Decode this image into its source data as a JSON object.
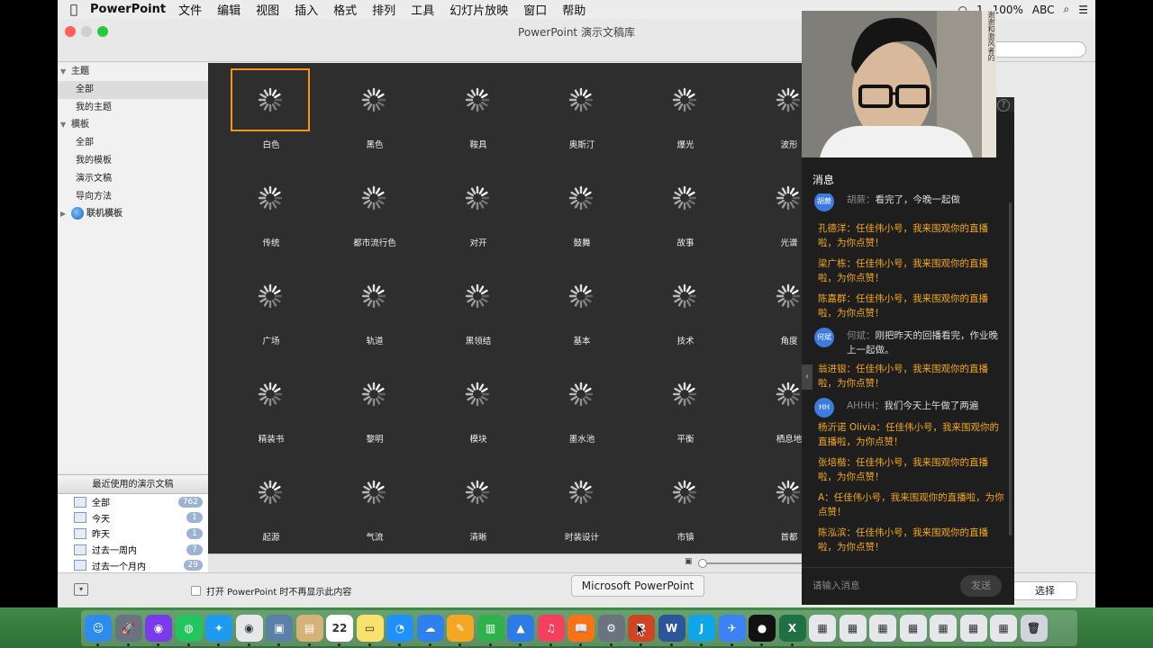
{
  "menubar": {
    "app": "PowerPoint",
    "items": [
      "文件",
      "编辑",
      "视图",
      "插入",
      "格式",
      "排列",
      "工具",
      "幻灯片放映",
      "窗口",
      "帮助"
    ],
    "status": {
      "badge": "1",
      "battery": "100%",
      "input": "ABC"
    }
  },
  "window": {
    "title": "PowerPoint 演示文稿库"
  },
  "sidebar": {
    "items": [
      {
        "label": "主题",
        "type": "head"
      },
      {
        "label": "全部",
        "type": "item",
        "selected": true
      },
      {
        "label": "我的主题",
        "type": "item"
      },
      {
        "label": "模板",
        "type": "head"
      },
      {
        "label": "全部",
        "type": "item"
      },
      {
        "label": "我的模板",
        "type": "item"
      },
      {
        "label": "演示文稿",
        "type": "item"
      },
      {
        "label": "导向方法",
        "type": "item"
      },
      {
        "label": "联机模板",
        "type": "online"
      }
    ]
  },
  "recent": {
    "header": "最近使用的演示文稿",
    "items": [
      {
        "label": "全部",
        "count": "762"
      },
      {
        "label": "今天",
        "count": "1"
      },
      {
        "label": "昨天",
        "count": "1"
      },
      {
        "label": "过去一周内",
        "count": "7"
      },
      {
        "label": "过去一个月内",
        "count": "29"
      }
    ]
  },
  "gallery": {
    "themes": [
      "白色",
      "黑色",
      "鞍具",
      "奥斯汀",
      "爆光",
      "波形",
      "传统",
      "都市流行色",
      "对开",
      "鼓舞",
      "故事",
      "光谱",
      "广场",
      "轨道",
      "黑领结",
      "基本",
      "技术",
      "角度",
      "精装书",
      "黎明",
      "模块",
      "墨水池",
      "平衡",
      "栖息地",
      "起源",
      "气流",
      "清晰",
      "时装设计",
      "市镇",
      "首都"
    ],
    "selected_index": 0
  },
  "footer": {
    "checkbox_label": "打开 PowerPoint 时不再显示此内容",
    "select_button": "选择"
  },
  "tooltip": "Microsoft PowerPoint",
  "webcam": {
    "side_text": "谢谢和激风者的"
  },
  "chat": {
    "title": "消息",
    "messages": [
      {
        "kind": "user",
        "avatar": "胡蕨",
        "name": "胡蕨：",
        "text": "看完了，今晚一起做"
      },
      {
        "kind": "gift",
        "text": "孔德洋：任佳伟小号，我来围观你的直播啦，为你点赞！"
      },
      {
        "kind": "gift",
        "text": "梁广栋：任佳伟小号，我来围观你的直播啦，为你点赞！"
      },
      {
        "kind": "gift",
        "text": "陈嘉群：任佳伟小号，我来围观你的直播啦，为你点赞！"
      },
      {
        "kind": "user",
        "avatar": "何斌",
        "name": "何斌：",
        "text": "刚把昨天的回播看完，作业晚上一起做。"
      },
      {
        "kind": "gift",
        "text": "翁进银：任佳伟小号，我来围观你的直播啦，为你点赞！"
      },
      {
        "kind": "user",
        "avatar": "HH",
        "name": "AHHH：",
        "text": "我们今天上午做了两遍"
      },
      {
        "kind": "gift",
        "text": "杨沂诺 Olivia：任佳伟小号，我来围观你的直播啦，为你点赞！"
      },
      {
        "kind": "gift",
        "text": "张培楷：任佳伟小号，我来围观你的直播啦，为你点赞！"
      },
      {
        "kind": "gift",
        "text": "A：任佳伟小号，我来围观你的直播啦，为你点赞！"
      },
      {
        "kind": "gift",
        "text": "陈泓滨：任佳伟小号，我来围观你的直播啦，为你点赞！"
      }
    ],
    "input_placeholder": "请输入消息",
    "send_label": "发送"
  },
  "dock": {
    "apps": [
      {
        "name": "finder",
        "color": "#2d8cf0",
        "glyph": "☺"
      },
      {
        "name": "launchpad",
        "color": "#6b7280",
        "glyph": "🚀"
      },
      {
        "name": "siri",
        "color": "#7c3aed",
        "glyph": "◉"
      },
      {
        "name": "wechat",
        "color": "#22c55e",
        "glyph": "◍"
      },
      {
        "name": "safari",
        "color": "#1d9bf0",
        "glyph": "✦"
      },
      {
        "name": "chrome",
        "color": "#e5e7eb",
        "glyph": "◉"
      },
      {
        "name": "preview",
        "color": "#5b7fa6",
        "glyph": "▣"
      },
      {
        "name": "contacts",
        "color": "#d6b17a",
        "glyph": "▤"
      },
      {
        "name": "calendar",
        "color": "#ffffff",
        "glyph": "22"
      },
      {
        "name": "notes",
        "color": "#f8e16c",
        "glyph": "▭"
      },
      {
        "name": "qq",
        "color": "#1e90ff",
        "glyph": "◔"
      },
      {
        "name": "baidu-netdisk",
        "color": "#2f80ed",
        "glyph": "☁"
      },
      {
        "name": "pages",
        "color": "#f5a623",
        "glyph": "✎"
      },
      {
        "name": "numbers",
        "color": "#2fb24c",
        "glyph": "▥"
      },
      {
        "name": "keynote",
        "color": "#2d7be5",
        "glyph": "▲"
      },
      {
        "name": "itunes",
        "color": "#f43f5e",
        "glyph": "♫"
      },
      {
        "name": "ibooks",
        "color": "#f97316",
        "glyph": "📖"
      },
      {
        "name": "system-preferences",
        "color": "#6b7280",
        "glyph": "⚙"
      },
      {
        "name": "powerpoint",
        "color": "#d04423",
        "glyph": "P"
      },
      {
        "name": "word",
        "color": "#2b579a",
        "glyph": "W"
      },
      {
        "name": "ding",
        "color": "#0ea5e9",
        "glyph": "J"
      },
      {
        "name": "message",
        "color": "#3b82f6",
        "glyph": "✈"
      },
      {
        "name": "recorder",
        "color": "#111111",
        "glyph": "●"
      },
      {
        "name": "excel",
        "color": "#1e7145",
        "glyph": "X"
      },
      {
        "name": "doc-1",
        "color": "#e5e7eb",
        "glyph": "▦"
      },
      {
        "name": "doc-2",
        "color": "#e5e7eb",
        "glyph": "▦"
      },
      {
        "name": "doc-3",
        "color": "#e5e7eb",
        "glyph": "▦"
      },
      {
        "name": "doc-4",
        "color": "#e5e7eb",
        "glyph": "▦"
      },
      {
        "name": "doc-5",
        "color": "#e5e7eb",
        "glyph": "▦"
      },
      {
        "name": "doc-6",
        "color": "#e5e7eb",
        "glyph": "▦"
      },
      {
        "name": "doc-7",
        "color": "#e5e7eb",
        "glyph": "▦"
      },
      {
        "name": "trash",
        "color": "#d1d5db",
        "glyph": "🗑"
      }
    ]
  }
}
